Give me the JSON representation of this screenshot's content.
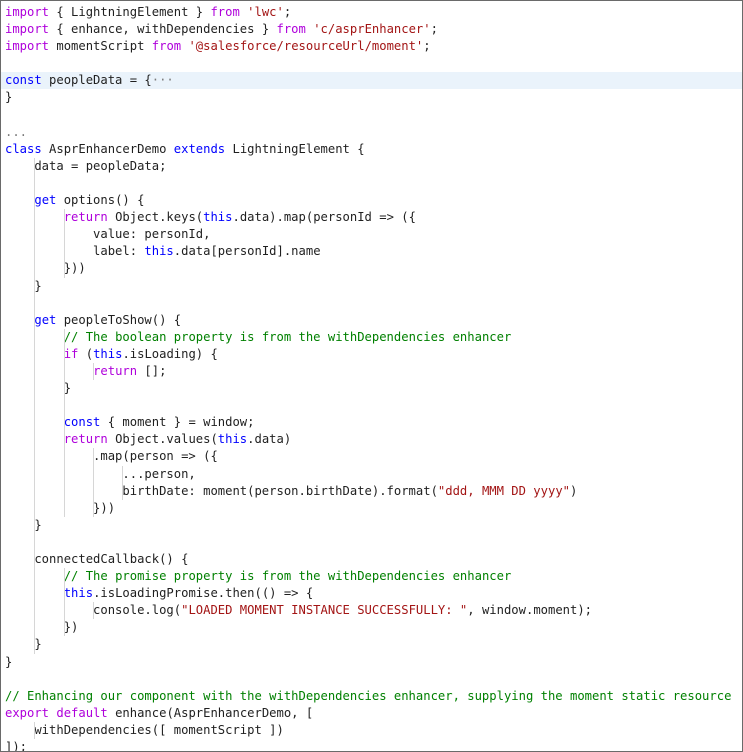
{
  "editor": {
    "lines": [
      [
        {
          "t": "import",
          "c": "ctl"
        },
        {
          "t": " { LightningElement } "
        },
        {
          "t": "from",
          "c": "ctl"
        },
        {
          "t": " "
        },
        {
          "t": "'lwc'",
          "c": "str"
        },
        {
          "t": ";"
        }
      ],
      [
        {
          "t": "import",
          "c": "ctl"
        },
        {
          "t": " { enhance, withDependencies } "
        },
        {
          "t": "from",
          "c": "ctl"
        },
        {
          "t": " "
        },
        {
          "t": "'c/asprEnhancer'",
          "c": "str"
        },
        {
          "t": ";"
        }
      ],
      [
        {
          "t": "import",
          "c": "ctl"
        },
        {
          "t": " momentScript "
        },
        {
          "t": "from",
          "c": "ctl"
        },
        {
          "t": " "
        },
        {
          "t": "'@salesforce/resourceUrl/moment'",
          "c": "str"
        },
        {
          "t": ";"
        }
      ],
      [],
      [
        {
          "t": "const",
          "c": "kw"
        },
        {
          "t": " peopleData = {"
        },
        {
          "t": "···",
          "c": "fold"
        }
      ],
      [
        {
          "t": "}"
        }
      ],
      [],
      [
        {
          "t": "...",
          "c": "fold"
        }
      ],
      [
        {
          "t": "class",
          "c": "kw"
        },
        {
          "t": " AsprEnhancerDemo "
        },
        {
          "t": "extends",
          "c": "kw"
        },
        {
          "t": " LightningElement {"
        }
      ],
      [
        {
          "t": "    data = peopleData;"
        }
      ],
      [],
      [
        {
          "t": "    "
        },
        {
          "t": "get",
          "c": "kw"
        },
        {
          "t": " options() {"
        }
      ],
      [
        {
          "t": "        "
        },
        {
          "t": "return",
          "c": "ctl"
        },
        {
          "t": " Object.keys("
        },
        {
          "t": "this",
          "c": "kw"
        },
        {
          "t": ".data).map(personId => ({"
        }
      ],
      [
        {
          "t": "            value: personId,"
        }
      ],
      [
        {
          "t": "            label: "
        },
        {
          "t": "this",
          "c": "kw"
        },
        {
          "t": ".data[personId].name"
        }
      ],
      [
        {
          "t": "        }))"
        }
      ],
      [
        {
          "t": "    }"
        }
      ],
      [],
      [
        {
          "t": "    "
        },
        {
          "t": "get",
          "c": "kw"
        },
        {
          "t": " peopleToShow() {"
        }
      ],
      [
        {
          "t": "        "
        },
        {
          "t": "// The boolean property is from the withDependencies enhancer",
          "c": "cmt"
        }
      ],
      [
        {
          "t": "        "
        },
        {
          "t": "if",
          "c": "ctl"
        },
        {
          "t": " ("
        },
        {
          "t": "this",
          "c": "kw"
        },
        {
          "t": ".isLoading) {"
        }
      ],
      [
        {
          "t": "            "
        },
        {
          "t": "return",
          "c": "ctl"
        },
        {
          "t": " [];"
        }
      ],
      [
        {
          "t": "        }"
        }
      ],
      [],
      [
        {
          "t": "        "
        },
        {
          "t": "const",
          "c": "kw"
        },
        {
          "t": " { moment } = window;"
        }
      ],
      [
        {
          "t": "        "
        },
        {
          "t": "return",
          "c": "ctl"
        },
        {
          "t": " Object.values("
        },
        {
          "t": "this",
          "c": "kw"
        },
        {
          "t": ".data)"
        }
      ],
      [
        {
          "t": "            .map(person => ({"
        }
      ],
      [
        {
          "t": "                ...person,"
        }
      ],
      [
        {
          "t": "                birthDate: moment(person.birthDate).format("
        },
        {
          "t": "\"ddd, MMM DD yyyy\"",
          "c": "str"
        },
        {
          "t": ")"
        }
      ],
      [
        {
          "t": "            }))"
        }
      ],
      [
        {
          "t": "    }"
        }
      ],
      [],
      [
        {
          "t": "    connectedCallback() {"
        }
      ],
      [
        {
          "t": "        "
        },
        {
          "t": "// The promise property is from the withDependencies enhancer",
          "c": "cmt"
        }
      ],
      [
        {
          "t": "        "
        },
        {
          "t": "this",
          "c": "kw"
        },
        {
          "t": ".isLoadingPromise.then(() => {"
        }
      ],
      [
        {
          "t": "            console.log("
        },
        {
          "t": "\"LOADED MOMENT INSTANCE SUCCESSFULLY: \"",
          "c": "str"
        },
        {
          "t": ", window.moment);"
        }
      ],
      [
        {
          "t": "        })"
        }
      ],
      [
        {
          "t": "    }"
        }
      ],
      [
        {
          "t": "}"
        }
      ],
      [],
      [
        {
          "t": "// Enhancing our component with the withDependencies enhancer, supplying the moment static resource",
          "c": "cmt"
        }
      ],
      [
        {
          "t": "export",
          "c": "ctl"
        },
        {
          "t": " "
        },
        {
          "t": "default",
          "c": "ctl"
        },
        {
          "t": " enhance(AsprEnhancerDemo, ["
        }
      ],
      [
        {
          "t": "    withDependencies([ momentScript ])"
        }
      ],
      [
        {
          "t": "]);"
        }
      ]
    ]
  }
}
